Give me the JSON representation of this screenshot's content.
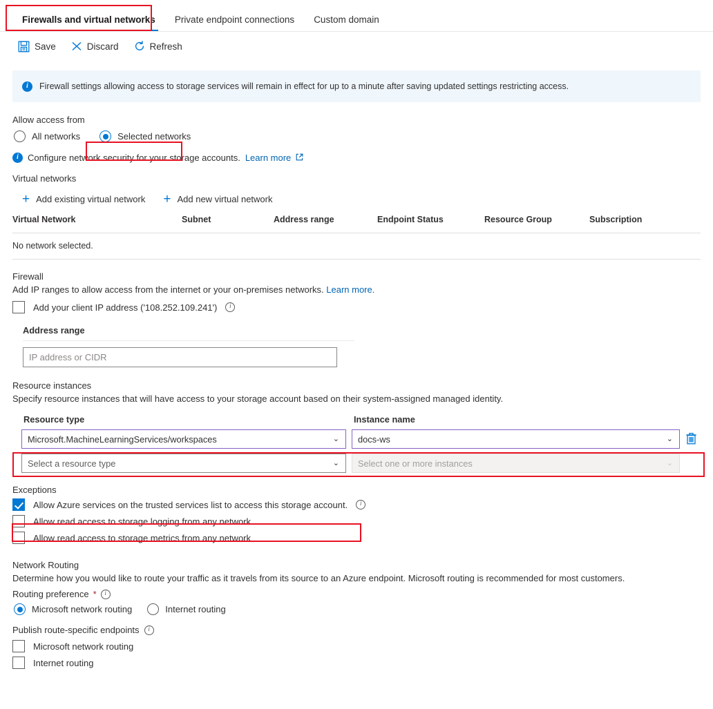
{
  "tabs": [
    {
      "label": "Firewalls and virtual networks",
      "active": true
    },
    {
      "label": "Private endpoint connections",
      "active": false
    },
    {
      "label": "Custom domain",
      "active": false
    }
  ],
  "toolbar": {
    "save_label": "Save",
    "discard_label": "Discard",
    "refresh_label": "Refresh"
  },
  "banner": {
    "icon": "info-icon",
    "text": "Firewall settings allowing access to storage services will remain in effect for up to a minute after saving updated settings restricting access."
  },
  "allow_access": {
    "label": "Allow access from",
    "options": [
      {
        "label": "All networks",
        "selected": false
      },
      {
        "label": "Selected networks",
        "selected": true
      }
    ],
    "note_text": "Configure network security for your storage accounts.",
    "note_link": "Learn more"
  },
  "virtual_networks": {
    "label": "Virtual networks",
    "add_existing_label": "Add existing virtual network",
    "add_new_label": "Add new virtual network",
    "columns": [
      "Virtual Network",
      "Subnet",
      "Address range",
      "Endpoint Status",
      "Resource Group",
      "Subscription"
    ],
    "empty_text": "No network selected."
  },
  "firewall": {
    "label": "Firewall",
    "description": "Add IP ranges to allow access from the internet or your on-premises networks.",
    "description_link": "Learn more.",
    "client_ip_checkbox": {
      "label": "Add your client IP address ('108.252.109.241')",
      "checked": false
    },
    "address_range_label": "Address range",
    "address_range_value": "",
    "address_range_placeholder": "IP address or CIDR"
  },
  "resource_instances": {
    "label": "Resource instances",
    "description": "Specify resource instances that will have access to your storage account based on their system-assigned managed identity.",
    "col_resource_type": "Resource type",
    "col_instance_name": "Instance name",
    "rows": [
      {
        "resource_type": "Microsoft.MachineLearningServices/workspaces",
        "instance_name": "docs-ws",
        "filled": true,
        "delete_icon": "trash-icon"
      },
      {
        "resource_type": "Select a resource type",
        "instance_name": "Select one or more instances",
        "filled": false
      }
    ]
  },
  "exceptions": {
    "label": "Exceptions",
    "items": [
      {
        "label": "Allow Azure services on the trusted services list to access this storage account.",
        "checked": true,
        "has_info": true
      },
      {
        "label": "Allow read access to storage logging from any network",
        "checked": false,
        "has_info": false
      },
      {
        "label": "Allow read access to storage metrics from any network",
        "checked": false,
        "has_info": false
      }
    ]
  },
  "network_routing": {
    "label": "Network Routing",
    "description": "Determine how you would like to route your traffic as it travels from its source to an Azure endpoint. Microsoft routing is recommended for most customers.",
    "routing_preference_label": "Routing preference",
    "routing_required_marker": "*",
    "routing_options": [
      {
        "label": "Microsoft network routing",
        "selected": true
      },
      {
        "label": "Internet routing",
        "selected": false
      }
    ],
    "publish_label": "Publish route-specific endpoints",
    "publish_options": [
      {
        "label": "Microsoft network routing",
        "checked": false
      },
      {
        "label": "Internet routing",
        "checked": false
      }
    ]
  },
  "colors": {
    "accent": "#0078d4",
    "highlight": "#e81123",
    "dropdown_border": "#8661c5",
    "banner_bg": "#eff6fc",
    "link": "#0065b3"
  }
}
